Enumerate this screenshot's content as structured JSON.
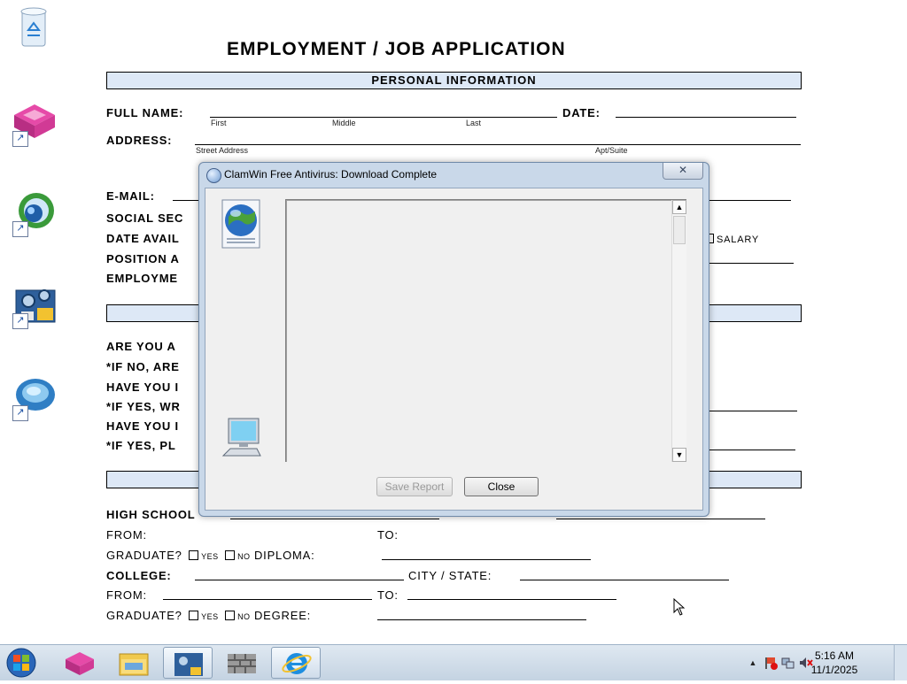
{
  "desktop": {
    "icons": [
      {
        "name": "recycle-bin",
        "icon": "recycle-bin-icon"
      },
      {
        "name": "pink-cube-app",
        "icon": "pink-cube-icon",
        "shortcut": true
      },
      {
        "name": "globe-connect-app",
        "icon": "globe-connect-icon",
        "shortcut": true
      },
      {
        "name": "system-settings-app",
        "icon": "settings-gears-icon",
        "shortcut": true
      },
      {
        "name": "teal-stone-app",
        "icon": "teal-stone-icon",
        "shortcut": true
      }
    ]
  },
  "form": {
    "title": "EMPLOYMENT / JOB APPLICATION",
    "section_personal": "PERSONAL INFORMATION",
    "full_name_label": "FULL NAME:",
    "first": "First",
    "middle": "Middle",
    "last": "Last",
    "date_label": "DATE:",
    "address_label": "ADDRESS:",
    "street_address": "Street Address",
    "apt_suite": "Apt/Suite",
    "email_label": "E-MAIL:",
    "social_label": "SOCIAL SEC",
    "date_avail_label": "DATE AVAIL",
    "position_label": "POSITION A",
    "employment_label": "EMPLOYME",
    "salary_label": "SALARY",
    "are_you_label": "ARE YOU A",
    "if_no_label": "*IF NO, ARE",
    "have_you_1_label": "HAVE YOU I",
    "if_yes_wr_label": "*IF YES, WR",
    "have_you_2_label": "HAVE YOU I",
    "if_yes_pl_label": "*IF YES, PL",
    "high_school_label": "HIGH SCHOOL",
    "from_label": "FROM:",
    "to_label": "TO:",
    "graduate_label": "GRADUATE?",
    "yes": "YES",
    "no": "NO",
    "diploma_label": "DIPLOMA:",
    "college_label": "COLLEGE:",
    "city_state_label": "CITY / STATE:",
    "degree_label": "DEGREE:"
  },
  "dialog": {
    "title": "ClamWin Free Antivirus: Download Complete",
    "save_report": "Save Report",
    "close": "Close",
    "close_icon_glyph": "✕",
    "scroll_up_glyph": "▲",
    "scroll_down_glyph": "▼"
  },
  "taskbar": {
    "time": "5:16 AM",
    "date": "11/1/2025",
    "tray_arrow": "▲"
  },
  "colors": {
    "band": "#dde8f6",
    "dialog_frame": "#c9d8e9",
    "taskbar": "#c4d3e2"
  }
}
